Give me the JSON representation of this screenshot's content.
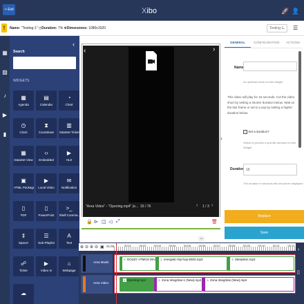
{
  "topbar": {
    "exit_label": "Exit",
    "logo_x": "X",
    "logo_rest": "ibo"
  },
  "info": {
    "name_label": "Name:",
    "name_value": "\"Testing-1\"",
    "duration_label": "Duration:",
    "duration_value": "7%",
    "dimensions_label": "Dimensions:",
    "dimensions_value": "1080x1920",
    "layout_select": "Testing-1"
  },
  "toolbox": {
    "search_label": "Search",
    "widgets_label": "WIDGETS",
    "widgets": [
      {
        "label": "Agenda",
        "icon": "▦"
      },
      {
        "label": "Calendar",
        "icon": "▤"
      },
      {
        "label": "Chart",
        "icon": "◔"
      },
      {
        "label": "Clock",
        "icon": "◷"
      },
      {
        "label": "Countdown",
        "icon": "⧗"
      },
      {
        "label": "DataSet Ticker",
        "icon": "▥"
      },
      {
        "label": "DataSet View",
        "icon": "▦"
      },
      {
        "label": "Embedded",
        "icon": "‹›"
      },
      {
        "label": "HLS",
        "icon": "▶"
      },
      {
        "label": "HTML Package",
        "icon": "▣"
      },
      {
        "label": "Local Video",
        "icon": "▶"
      },
      {
        "label": "Notification",
        "icon": "✉"
      },
      {
        "label": "PDF",
        "icon": "▯"
      },
      {
        "label": "PowerPoint",
        "icon": "▯"
      },
      {
        "label": "Shell Comma...",
        "icon": ">_"
      },
      {
        "label": "Spacer",
        "icon": "⇕"
      },
      {
        "label": "Sub-Playlist",
        "icon": "☰"
      },
      {
        "label": "Text",
        "icon": "A"
      },
      {
        "label": "Ticker",
        "icon": "☍"
      },
      {
        "label": "Video In",
        "icon": "▶"
      },
      {
        "label": "Webpage",
        "icon": "⌂"
      },
      {
        "label": "",
        "icon": "☁"
      }
    ]
  },
  "preview": {
    "region_label": "\"Area Video\" - \"Opening.mp4\" (e...",
    "item_counter": "16 / 76",
    "page_counter": "1 / 3"
  },
  "properties": {
    "tabs": [
      "GENERAL",
      "CONFIGURATION",
      "ACTIONS"
    ],
    "name_label": "Name",
    "name_hint": "An optional name for this widget",
    "info_text": "This video will play for 15 seconds. Cut the video short by setting a shorter duration below. Wait on the last frame or set to Loop by setting a higher duration below.",
    "set_duration_label": "Set a duration?",
    "set_duration_hint": "Select to provide a specific duration for this Widget",
    "duration_label": "Duration",
    "duration_value": "15",
    "duration_hint": "The duration in seconds this should be displayed",
    "replace_label": "Replace",
    "save_label": "Save"
  },
  "timeline": {
    "time_start": "01:55",
    "tick_labels": [
      "00:01",
      "00:02",
      "00:03",
      "00:04",
      "00:05",
      "00:06",
      "00:07",
      "00:08",
      "00:09",
      "00:10",
      "00:11",
      "00:12"
    ],
    "tracks": [
      {
        "name": "Area Musik",
        "clips": [
          {
            "num": "1",
            "label": "DOLBY ATMOS MASTE..."
          },
          {
            "num": "2",
            "label": "energetic-hip-hop-8303.mp3"
          },
          {
            "num": "3",
            "label": "Sleepless.mp3"
          }
        ]
      },
      {
        "name": "Area Video",
        "clips": [
          {
            "num": "1",
            "label": "Opening.mp4"
          },
          {
            "num": "2",
            "label": "Zona Integritas-1 (New).mp4"
          },
          {
            "num": "3",
            "label": "Zona Integritas (New).mp4"
          }
        ]
      }
    ]
  },
  "colors": {
    "nav": "#273759",
    "toolbox": "#2c4177",
    "accent": "#1f6fb2",
    "replace": "#f2ad1d",
    "save": "#2aa3cf",
    "clip_green": "#43a047",
    "clip_purple": "#9c27b0"
  }
}
